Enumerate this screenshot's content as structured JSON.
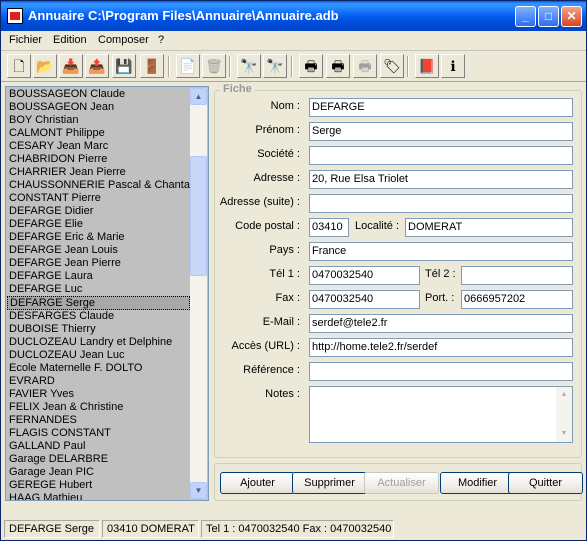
{
  "window": {
    "title": "Annuaire C:\\Program Files\\Annuaire\\Annuaire.adb"
  },
  "menu": [
    "Fichier",
    "Edition",
    "Composer",
    "?"
  ],
  "toolbar": [
    {
      "icon": "new-document-icon",
      "glyph": "🗋",
      "disabled": false
    },
    {
      "icon": "open-folder-icon",
      "glyph": "📂",
      "disabled": false
    },
    {
      "icon": "import-icon",
      "glyph": "📥",
      "disabled": false
    },
    {
      "icon": "export-icon",
      "glyph": "📤",
      "disabled": false
    },
    {
      "icon": "save-icon",
      "glyph": "💾",
      "disabled": false
    },
    {
      "icon": "exit-icon",
      "glyph": "🚪",
      "disabled": false
    },
    {
      "icon": "copy-icon",
      "glyph": "📄",
      "disabled": false
    },
    {
      "icon": "delete-icon",
      "glyph": "🗑",
      "disabled": true
    },
    {
      "icon": "find-icon",
      "glyph": "🔭",
      "disabled": false
    },
    {
      "icon": "find-next-icon",
      "glyph": "🔭",
      "disabled": true
    },
    {
      "icon": "print-icon",
      "glyph": "🖶",
      "disabled": false
    },
    {
      "icon": "print-preview-icon",
      "glyph": "🖶",
      "disabled": false
    },
    {
      "icon": "print-setup-icon",
      "glyph": "🖶",
      "disabled": true
    },
    {
      "icon": "label-print-icon",
      "glyph": "🏷",
      "disabled": false
    },
    {
      "icon": "help-book-icon",
      "glyph": "📕",
      "disabled": false
    },
    {
      "icon": "info-icon",
      "glyph": "ℹ",
      "disabled": false
    }
  ],
  "contacts": [
    "BOUSSAGEON Claude",
    "BOUSSAGEON Jean",
    "BOY Christian",
    "CALMONT Philippe",
    "CESARY Jean Marc",
    "CHABRIDON Pierre",
    "CHARRIER Jean Pierre",
    "CHAUSSONNERIE Pascal & Chantal",
    "CONSTANT Pierre",
    "DEFARGE Didier",
    "DEFARGE Elie",
    "DEFARGE Eric & Marie",
    "DEFARGE Jean Louis",
    "DEFARGE Jean Pierre",
    "DEFARGE Laura",
    "DEFARGE Luc",
    "DEFARGE Serge",
    "DESFARGES Claude",
    "DUBOISE Thierry",
    "DUCLOZEAU Landry et Delphine",
    "DUCLOZEAU Jean Luc",
    "Ecole Maternelle F. DOLTO",
    "EVRARD",
    "FAVIER Yves",
    "FELIX Jean & Christine",
    "FERNANDES",
    "FLAGIS CONSTANT",
    "GALLAND Paul",
    "Garage DELARBRE",
    "Garage Jean PIC",
    "GEREGE Hubert",
    "HAAG Mathieu"
  ],
  "selected_index": 16,
  "fiche": {
    "legend": "Fiche",
    "labels": {
      "nom": "Nom :",
      "prenom": "Prénom :",
      "societe": "Société :",
      "adresse": "Adresse :",
      "adresse_suite": "Adresse (suite) :",
      "code_postal": "Code postal :",
      "localite": "Localité :",
      "pays": "Pays :",
      "tel1": "Tél 1 :",
      "tel2": "Tél 2 :",
      "fax": "Fax :",
      "port": "Port. :",
      "email": "E-Mail :",
      "acces_url": "Accès (URL) :",
      "reference": "Référence :",
      "notes": "Notes :"
    },
    "values": {
      "nom": "DEFARGE",
      "prenom": "Serge",
      "societe": "",
      "adresse": "20, Rue Elsa Triolet",
      "adresse_suite": "",
      "code_postal": "03410",
      "localite": "DOMERAT",
      "pays": "France",
      "tel1": "0470032540",
      "tel2": "",
      "fax": "0470032540",
      "port": "0666957202",
      "email": "serdef@tele2.fr",
      "acces_url": "http://home.tele2.fr/serdef",
      "reference": "",
      "notes": ""
    }
  },
  "buttons": {
    "ajouter": "Ajouter",
    "supprimer": "Supprimer",
    "actualiser": "Actualiser",
    "modifier": "Modifier",
    "quitter": "Quitter"
  },
  "status": {
    "name": "DEFARGE Serge",
    "location": "03410 DOMERAT",
    "phones": "Tel 1 : 0470032540  Fax : 0470032540"
  }
}
